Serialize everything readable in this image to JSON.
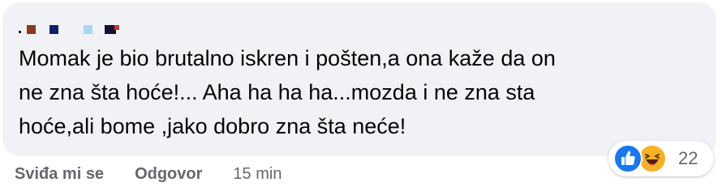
{
  "comment": {
    "text": "Momak je bio brutalno iskren i pošten,a ona kaže da on\nne zna šta hoće!... Aha ha ha ha...mozda i ne zna sta\nhoće,ali bome ,jako dobro zna šta neće!"
  },
  "reactions": {
    "icons": [
      "like-icon",
      "haha-icon"
    ],
    "count": "22",
    "like_color": "#1877f2",
    "haha_color": "#f7b125"
  },
  "actions": {
    "like_label": "Sviđa mi se",
    "reply_label": "Odgovor",
    "timestamp": "15 min"
  },
  "colors": {
    "bubble_bg": "#f0f2f5",
    "text": "#050505",
    "meta_text": "#65676b"
  }
}
